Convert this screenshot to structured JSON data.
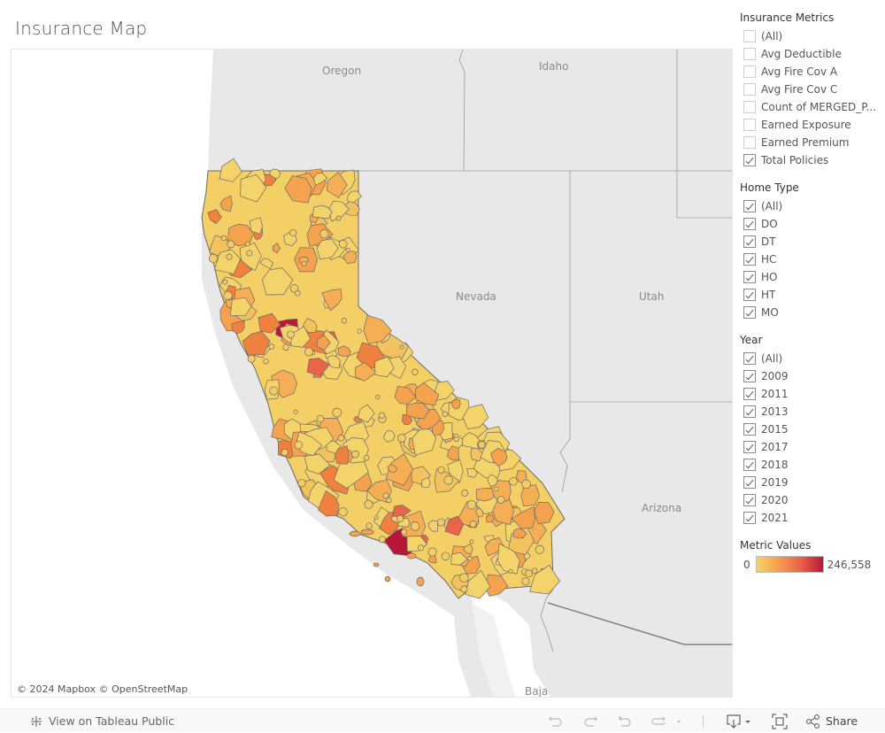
{
  "title": "Insurance Map",
  "map": {
    "attribution": "© 2024 Mapbox  © OpenStreetMap",
    "state_labels": [
      "Oregon",
      "Idaho",
      "Nevada",
      "Utah",
      "Arizona",
      "Baja"
    ],
    "color_scale": {
      "low": "#f4d36a",
      "mid": "#f0803e",
      "high": "#b9173a"
    }
  },
  "filters": {
    "insurance_metrics": {
      "title": "Insurance Metrics",
      "items": [
        {
          "label": "(All)",
          "checked": false
        },
        {
          "label": "Avg Deductible",
          "checked": false
        },
        {
          "label": "Avg Fire Cov A",
          "checked": false
        },
        {
          "label": "Avg Fire Cov C",
          "checked": false
        },
        {
          "label": "Count of MERGED_P...",
          "checked": false
        },
        {
          "label": "Earned Exposure",
          "checked": false
        },
        {
          "label": "Earned Premium",
          "checked": false
        },
        {
          "label": "Total Policies",
          "checked": true
        }
      ]
    },
    "home_type": {
      "title": "Home Type",
      "items": [
        {
          "label": "(All)",
          "checked": true
        },
        {
          "label": "DO",
          "checked": true
        },
        {
          "label": "DT",
          "checked": true
        },
        {
          "label": "HC",
          "checked": true
        },
        {
          "label": "HO",
          "checked": true
        },
        {
          "label": "HT",
          "checked": true
        },
        {
          "label": "MO",
          "checked": true
        }
      ]
    },
    "year": {
      "title": "Year",
      "items": [
        {
          "label": "(All)",
          "checked": true
        },
        {
          "label": "2009",
          "checked": true
        },
        {
          "label": "2011",
          "checked": true
        },
        {
          "label": "2013",
          "checked": true
        },
        {
          "label": "2015",
          "checked": true
        },
        {
          "label": "2017",
          "checked": true
        },
        {
          "label": "2018",
          "checked": true
        },
        {
          "label": "2019",
          "checked": true
        },
        {
          "label": "2020",
          "checked": true
        },
        {
          "label": "2021",
          "checked": true
        }
      ]
    }
  },
  "legend": {
    "title": "Metric Values",
    "min_label": "0",
    "max_label": "246,558"
  },
  "toolbar": {
    "view_on_label": "View on Tableau Public",
    "share_label": "Share",
    "icons": [
      "tableau-logo-icon",
      "undo-icon",
      "redo-icon",
      "revert-icon",
      "refresh-icon",
      "download-icon",
      "fullscreen-icon",
      "share-icon"
    ]
  }
}
